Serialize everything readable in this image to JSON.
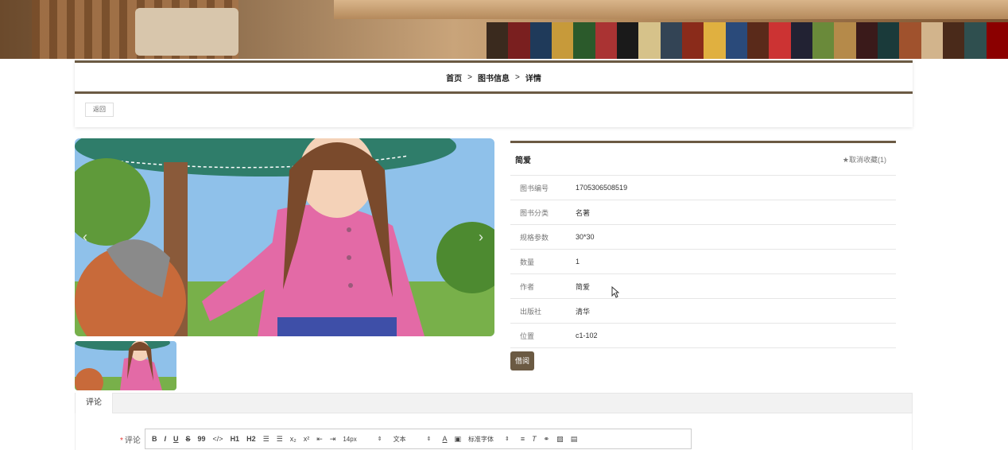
{
  "breadcrumb": {
    "home": "首页",
    "separator": ">",
    "section": "图书信息",
    "current": "详情"
  },
  "back_label": "返回",
  "book": {
    "title": "简爱",
    "favorite_label": "★取消收藏(1)",
    "fields": [
      {
        "label": "图书编号",
        "value": "1705306508519"
      },
      {
        "label": "图书分类",
        "value": "名著"
      },
      {
        "label": "规格参数",
        "value": "30*30"
      },
      {
        "label": "数量",
        "value": "1"
      },
      {
        "label": "作者",
        "value": "简爱"
      },
      {
        "label": "出版社",
        "value": "清华"
      },
      {
        "label": "位置",
        "value": "c1-102"
      }
    ],
    "borrow_label": "借阅"
  },
  "gallery": {
    "prev_icon": "chevron-left-icon",
    "next_icon": "chevron-right-icon"
  },
  "comment": {
    "tab_label": "评论",
    "field_label": "评论",
    "required_mark": "*",
    "toolbar": {
      "font_size": "14px",
      "text_style": "文本",
      "font_family": "标准字体",
      "bold": "B",
      "italic": "I",
      "underline": "U",
      "strike": "S",
      "quote": "99",
      "code": "</>",
      "h1": "H1",
      "h2": "H2",
      "subscript": "x₂",
      "superscript": "x²"
    }
  },
  "colors": {
    "accent": "#6b5a43",
    "required": "#e53935"
  }
}
